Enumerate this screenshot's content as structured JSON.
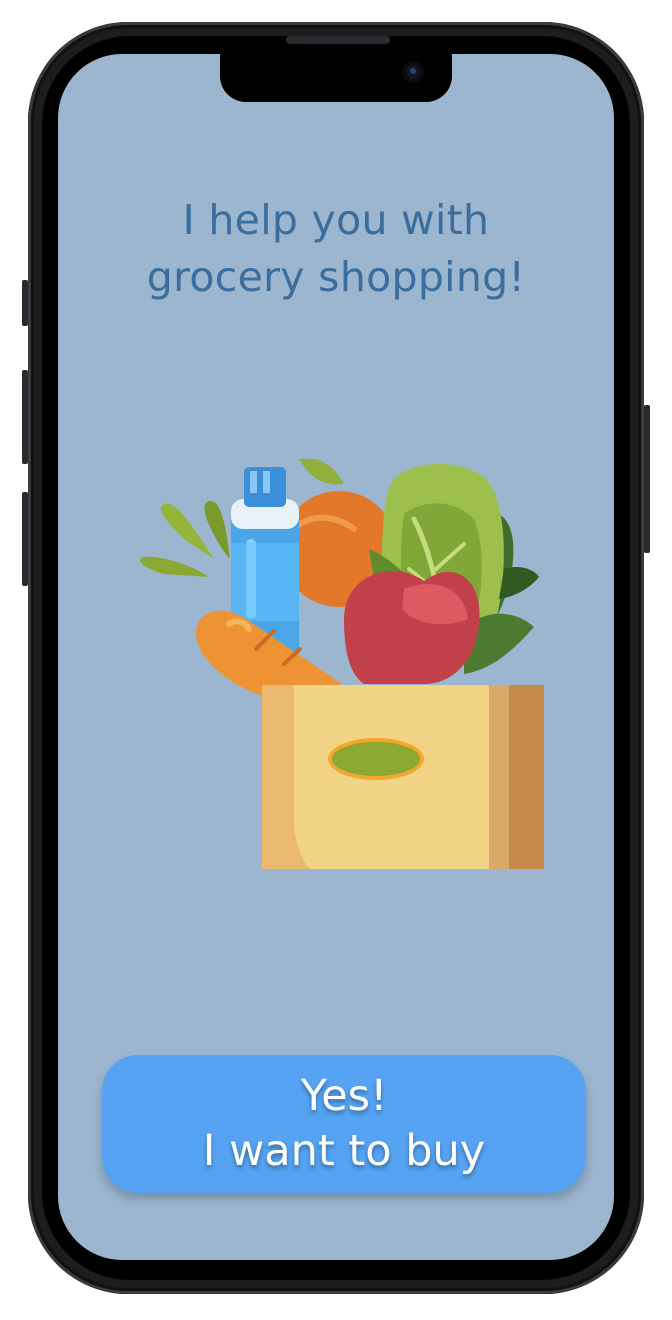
{
  "screen": {
    "headline": {
      "line1": "I help you with",
      "line2": "grocery shopping!"
    },
    "illustration_icon": "grocery-bag-icon",
    "cta": {
      "line1": "Yes!",
      "line2": "I want to buy"
    }
  },
  "colors": {
    "background": "#9cb6cf",
    "headline": "#3a6e9f",
    "button": "#55a3f2",
    "button_text": "#ffffff"
  }
}
